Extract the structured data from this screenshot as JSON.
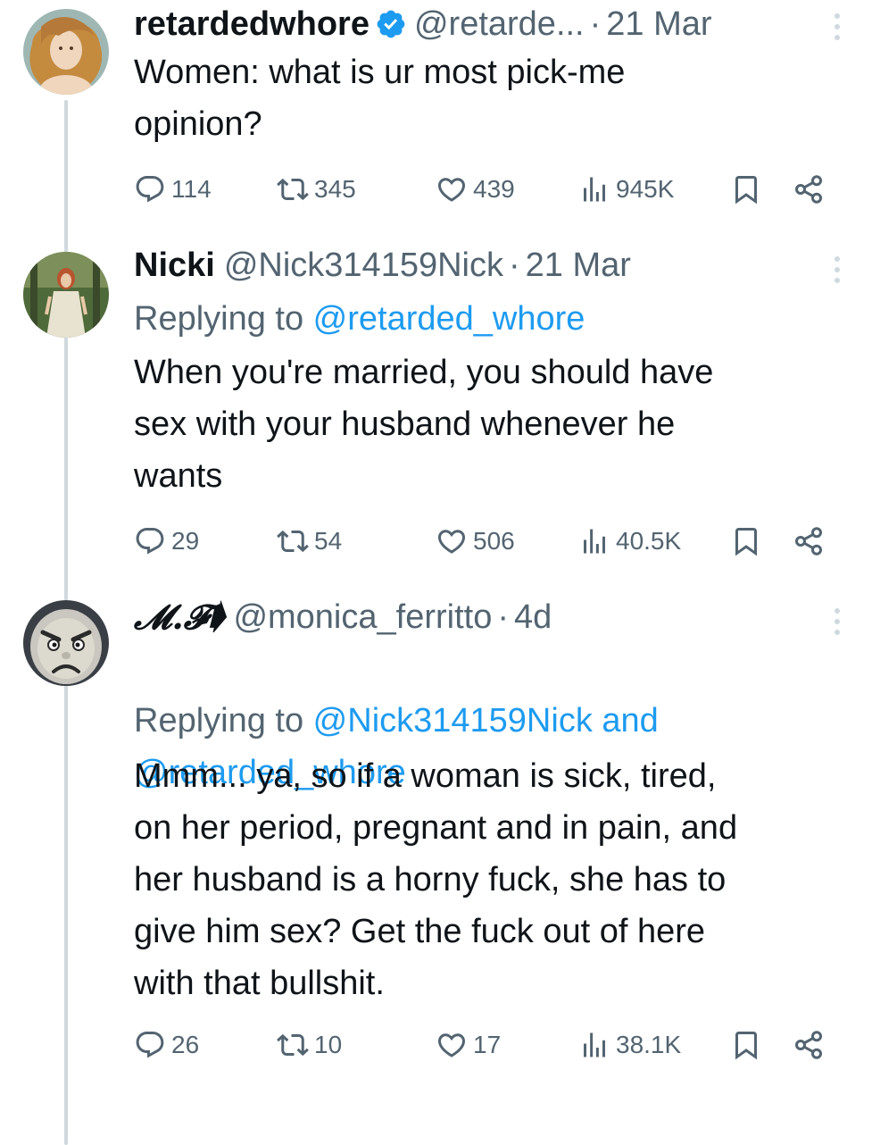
{
  "tweets": [
    {
      "display_name": "retardedwhore",
      "verified": true,
      "handle": "@retarde...",
      "separator": "·",
      "date": "21 Mar",
      "text": "Women: what is ur most pick-me\nopinion?",
      "stats": {
        "replies": "114",
        "retweets": "345",
        "likes": "439",
        "views": "945K"
      }
    },
    {
      "display_name": "Nicki",
      "verified": false,
      "handle": "@Nick314159Nick",
      "separator": "·",
      "date": "21 Mar",
      "replying_prefix": "Replying to ",
      "replying_mentions": "@retarded_whore",
      "text": "When you're married, you should have\nsex with your husband whenever he\nwants",
      "stats": {
        "replies": "29",
        "retweets": "54",
        "likes": "506",
        "views": "40.5K"
      }
    },
    {
      "display_name": "𝓜.𝓕➧",
      "verified": false,
      "handle": "@monica_ferritto",
      "separator": "·",
      "date": "4d",
      "replying_prefix": "Replying to ",
      "replying_mentions": "@Nick314159Nick and\n@retarded_whore",
      "text": "Mmm... ya, so if a woman is sick, tired,\non her period, pregnant and in pain, and\nher husband is a horny fuck, she has to\ngive him sex? Get the fuck out of here\nwith that bullshit.",
      "stats": {
        "replies": "26",
        "retweets": "10",
        "likes": "17",
        "views": "38.1K"
      }
    }
  ],
  "icons": {
    "reply": "reply-icon",
    "retweet": "retweet-icon",
    "like": "heart-icon",
    "views": "views-icon",
    "bookmark": "bookmark-icon",
    "share": "share-icon",
    "more": "more-icon",
    "verified": "verified-badge-icon"
  },
  "colors": {
    "text": "#0f1419",
    "secondary": "#536471",
    "accent": "#1d9bf0",
    "thread_line": "#cfd9de"
  }
}
